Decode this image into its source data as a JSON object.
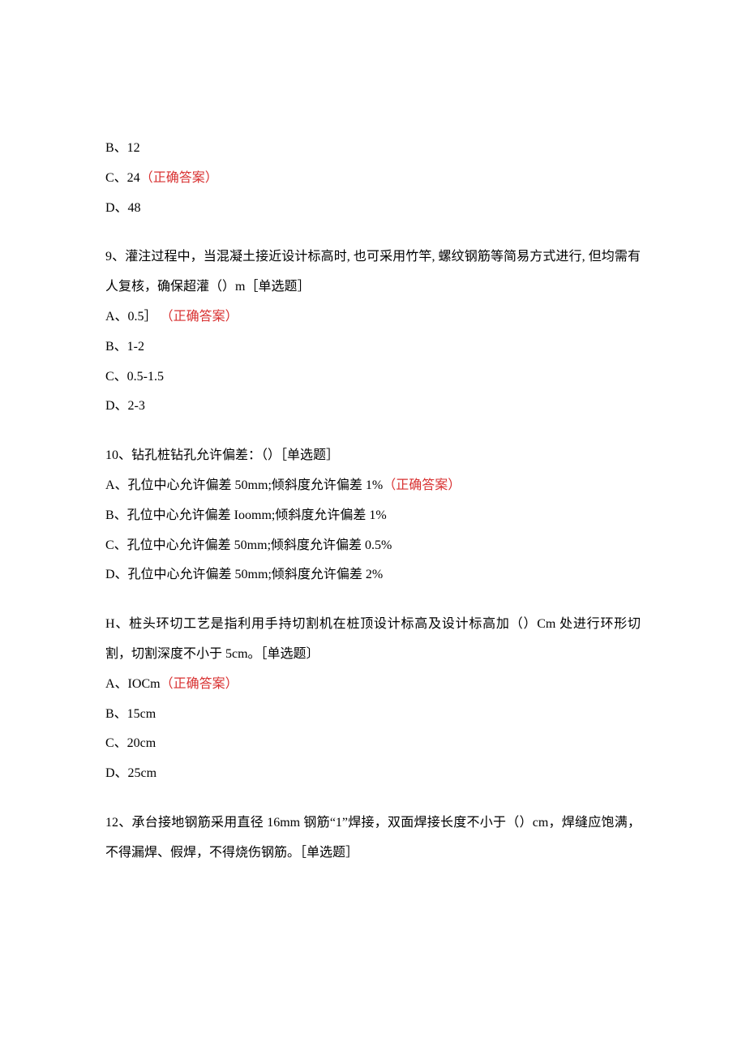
{
  "q8": {
    "optB": "B、12",
    "optC_pre": "C、24",
    "optC_ans": "（正确答案）",
    "optD": "D、48"
  },
  "q9": {
    "stem": "9、灌注过程中，当混凝土接近设计标高时, 也可采用竹竿, 螺纹钢筋等简易方式进行, 但均需有人复核，确保超灌（）m［单选题］",
    "optA_pre": "A、0.5］",
    "optA_ans": "（正确答案）",
    "optB": "B、1-2",
    "optC": "C、0.5-1.5",
    "optD": "D、2-3"
  },
  "q10": {
    "stem": "10、钻孔桩钻孔允许偏差：（）［单选题］",
    "optA_pre": "A、孔位中心允许偏差 50mm;倾斜度允许偏差 1%",
    "optA_ans": "（正确答案）",
    "optB": "B、孔位中心允许偏差 Ioomm;倾斜度允许偏差 1%",
    "optC": "C、孔位中心允许偏差 50mm;倾斜度允许偏差 0.5%",
    "optD": "D、孔位中心允许偏差 50mm;倾斜度允许偏差 2%"
  },
  "q11": {
    "stem": "H、桩头环切工艺是指利用手持切割机在桩顶设计标高及设计标高加（）Cm 处进行环形切割，切割深度不小于 5cm。［单选题〕",
    "optA_pre": "A、IOCm",
    "optA_ans": "（正确答案）",
    "optB": "B、15cm",
    "optC": "C、20cm",
    "optD": "D、25cm"
  },
  "q12": {
    "stem": "12、承台接地钢筋采用直径 16mm 钢筋“1”焊接，双面焊接长度不小于（）cm，焊缝应饱满，不得漏焊、假焊，不得烧伤钢筋。［单选题］"
  }
}
